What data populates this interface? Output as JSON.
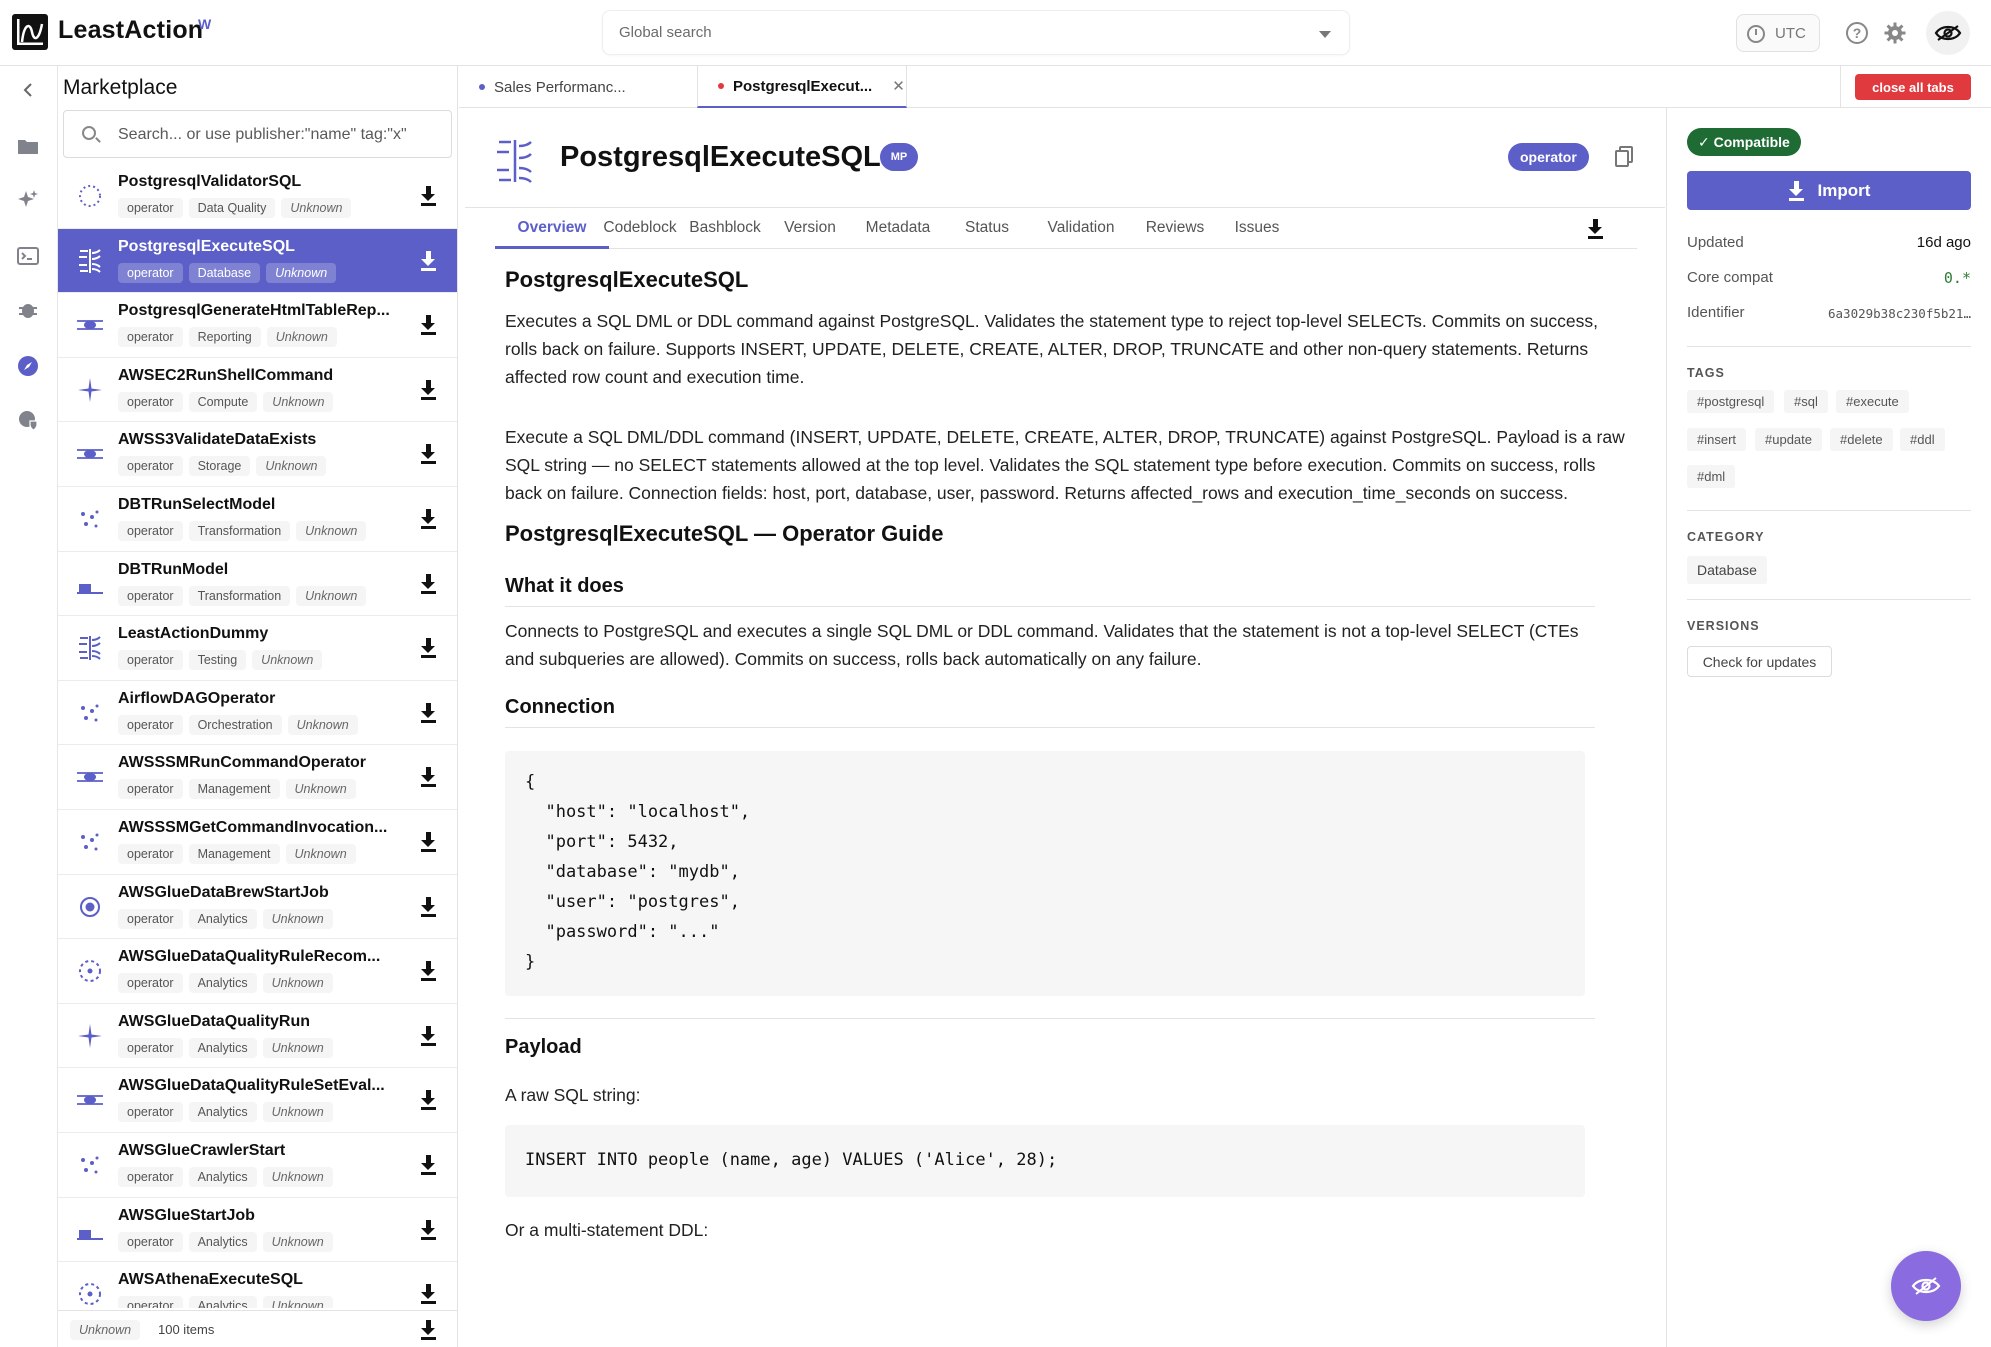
{
  "app": {
    "name": "LeastAction",
    "badge": "W"
  },
  "topbar": {
    "search_placeholder": "Global search",
    "timezone": "UTC"
  },
  "marketplace": {
    "title": "Marketplace",
    "search_placeholder": "Search... or use publisher:\"name\" tag:\"x\"",
    "items": [
      {
        "name": "PostgresqlValidatorSQL",
        "kind": "operator",
        "category": "Data Quality",
        "status": "Unknown",
        "icon": "dotted-circle-icon"
      },
      {
        "name": "PostgresqlExecuteSQL",
        "kind": "operator",
        "category": "Database",
        "status": "Unknown",
        "icon": "branch-bracket-icon",
        "selected": true
      },
      {
        "name": "PostgresqlGenerateHtmlTableRep...",
        "kind": "operator",
        "category": "Reporting",
        "status": "Unknown",
        "icon": "eye-lines-icon"
      },
      {
        "name": "AWSEC2RunShellCommand",
        "kind": "operator",
        "category": "Compute",
        "status": "Unknown",
        "icon": "sparkle-icon"
      },
      {
        "name": "AWSS3ValidateDataExists",
        "kind": "operator",
        "category": "Storage",
        "status": "Unknown",
        "icon": "eye-lines-icon"
      },
      {
        "name": "DBTRunSelectModel",
        "kind": "operator",
        "category": "Transformation",
        "status": "Unknown",
        "icon": "scatter-dots-icon"
      },
      {
        "name": "DBTRunModel",
        "kind": "operator",
        "category": "Transformation",
        "status": "Unknown",
        "icon": "base-bar-icon"
      },
      {
        "name": "LeastActionDummy",
        "kind": "operator",
        "category": "Testing",
        "status": "Unknown",
        "icon": "branch-bracket-icon"
      },
      {
        "name": "AirflowDAGOperator",
        "kind": "operator",
        "category": "Orchestration",
        "status": "Unknown",
        "icon": "scatter-dots-icon"
      },
      {
        "name": "AWSSSMRunCommandOperator",
        "kind": "operator",
        "category": "Management",
        "status": "Unknown",
        "icon": "eye-lines-icon"
      },
      {
        "name": "AWSSSMGetCommandInvocation...",
        "kind": "operator",
        "category": "Management",
        "status": "Unknown",
        "icon": "scatter-dots-icon"
      },
      {
        "name": "AWSGlueDataBrewStartJob",
        "kind": "operator",
        "category": "Analytics",
        "status": "Unknown",
        "icon": "target-icon"
      },
      {
        "name": "AWSGlueDataQualityRuleRecom...",
        "kind": "operator",
        "category": "Analytics",
        "status": "Unknown",
        "icon": "dotted-ring-icon"
      },
      {
        "name": "AWSGlueDataQualityRun",
        "kind": "operator",
        "category": "Analytics",
        "status": "Unknown",
        "icon": "sparkle-icon"
      },
      {
        "name": "AWSGlueDataQualityRuleSetEval...",
        "kind": "operator",
        "category": "Analytics",
        "status": "Unknown",
        "icon": "eye-lines-icon"
      },
      {
        "name": "AWSGlueCrawlerStart",
        "kind": "operator",
        "category": "Analytics",
        "status": "Unknown",
        "icon": "scatter-dots-icon"
      },
      {
        "name": "AWSGlueStartJob",
        "kind": "operator",
        "category": "Analytics",
        "status": "Unknown",
        "icon": "base-bar-icon"
      },
      {
        "name": "AWSAthenaExecuteSQL",
        "kind": "operator",
        "category": "Analytics",
        "status": "Unknown",
        "icon": "dotted-ring-icon"
      }
    ],
    "footer": {
      "status": "Unknown",
      "count": "100 items"
    }
  },
  "tabs": [
    {
      "label": "Sales Performanc...",
      "dot_color": "#5b5fc7",
      "active": false
    },
    {
      "label": "PostgresqlExecut...",
      "dot_color": "#e0393e",
      "active": true
    }
  ],
  "close_all_label": "close all tabs",
  "detail": {
    "title": "PostgresqlExecuteSQL",
    "mp_badge": "MP",
    "type_badge": "operator",
    "sub_tabs": [
      "Overview",
      "Codeblock",
      "Bashblock",
      "Version",
      "Metadata",
      "Status",
      "Validation",
      "Reviews",
      "Issues"
    ],
    "content": {
      "heading": "PostgresqlExecuteSQL",
      "para1": "Executes a SQL DML or DDL command against PostgreSQL. Validates the statement type to reject top-level SELECTs. Commits on success, rolls back on failure. Supports INSERT, UPDATE, DELETE, CREATE, ALTER, DROP, TRUNCATE and other non-query statements. Returns affected row count and execution time.",
      "para2": "Execute a SQL DML/DDL command (INSERT, UPDATE, DELETE, CREATE, ALTER, DROP, TRUNCATE) against PostgreSQL. Payload is a raw SQL string — no SELECT statements allowed at the top level. Validates the SQL statement type before execution. Commits on success, rolls back on failure. Connection fields: host, port, database, user, password. Returns affected_rows and execution_time_seconds on success.",
      "guide_heading": "PostgresqlExecuteSQL — Operator Guide",
      "what_heading": "What it does",
      "what_text": "Connects to PostgreSQL and executes a single SQL DML or DDL command. Validates that the statement is not a top-level SELECT (CTEs and subqueries are allowed). Commits on success, rolls back automatically on any failure.",
      "connection_heading": "Connection",
      "connection_code": "{\n  \"host\": \"localhost\",\n  \"port\": 5432,\n  \"database\": \"mydb\",\n  \"user\": \"postgres\",\n  \"password\": \"...\"\n}",
      "payload_heading": "Payload",
      "payload_text": "A raw SQL string:",
      "payload_code": "INSERT INTO people (name, age) VALUES ('Alice', 28);",
      "ddl_text": "Or a multi-statement DDL:"
    }
  },
  "side": {
    "compat": "✓ Compatible",
    "import_label": "Import",
    "updated_label": "Updated",
    "updated_value": "16d ago",
    "core_label": "Core compat",
    "core_value": "0.*",
    "id_label": "Identifier",
    "id_value": "6a3029b38c230f5b21…",
    "tags_head": "TAGS",
    "tags": [
      "#postgresql",
      "#sql",
      "#execute",
      "#insert",
      "#update",
      "#delete",
      "#ddl",
      "#dml"
    ],
    "category_head": "CATEGORY",
    "category": "Database",
    "versions_head": "VERSIONS",
    "check_label": "Check for updates"
  }
}
